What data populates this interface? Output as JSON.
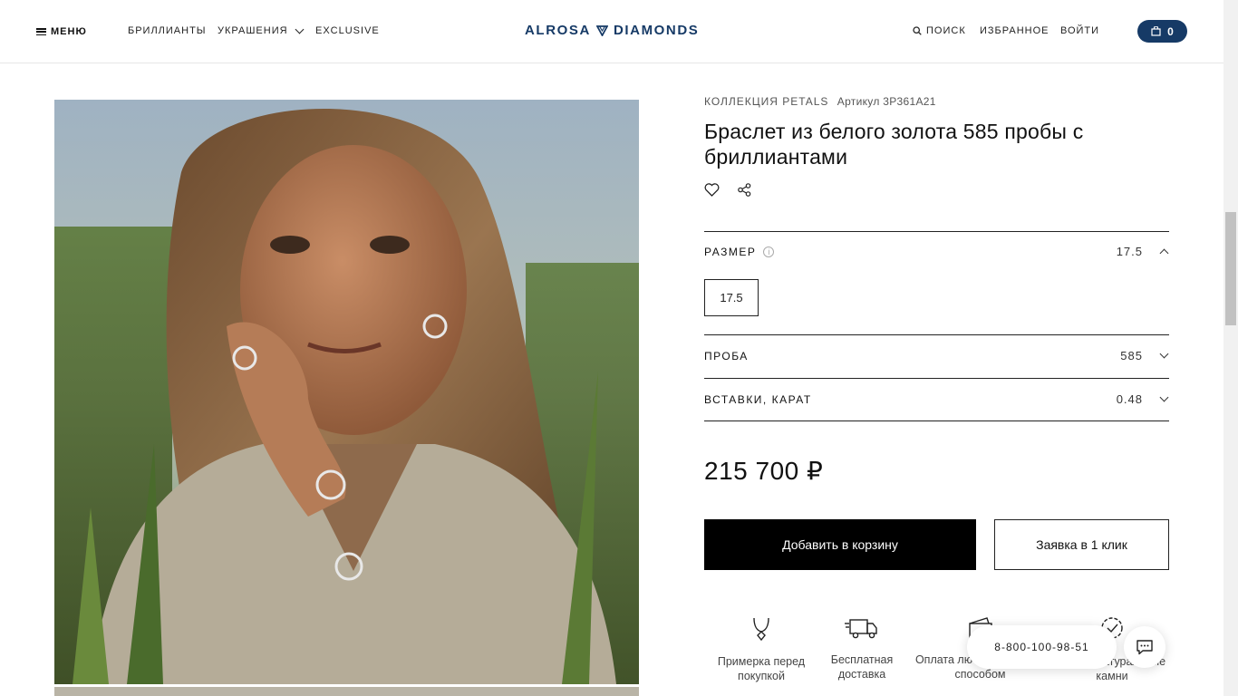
{
  "header": {
    "menu_label": "МЕНЮ",
    "nav": [
      "БРИЛЛИАНТЫ",
      "УКРАШЕНИЯ",
      "EXCLUSIVE"
    ],
    "logo_left": "ALROSA",
    "logo_right": "DIAMONDS",
    "search_label": "ПОИСК",
    "favorites_label": "ИЗБРАННОЕ",
    "login_label": "ВОЙТИ",
    "cart_count": "0",
    "brand_color": "#163a66"
  },
  "product": {
    "collection": "КОЛЛЕКЦИЯ PETALS",
    "article": "Артикул 3P361A21",
    "title": "Браслет из белого золота 585 пробы с бриллиантами",
    "options": {
      "size_label": "РАЗМЕР",
      "size_value": "17.5",
      "size_choices": [
        "17.5"
      ],
      "probe_label": "ПРОБА",
      "probe_value": "585",
      "inserts_label": "ВСТАВКИ, КАРАТ",
      "inserts_value": "0.48"
    },
    "price": "215 700 ₽",
    "add_to_cart": "Добавить в корзину",
    "one_click": "Заявка в 1 клик",
    "features": [
      {
        "icon": "necklace-icon",
        "text": "Примерка перед покупкой"
      },
      {
        "icon": "truck-icon",
        "text": "Бесплатная доставка"
      },
      {
        "icon": "wallet-icon",
        "text": "Оплата любым удобным способом"
      },
      {
        "icon": "certificate-icon",
        "text": "только натуральные камни"
      }
    ]
  },
  "contact": {
    "phone": "8-800-100-98-51"
  }
}
